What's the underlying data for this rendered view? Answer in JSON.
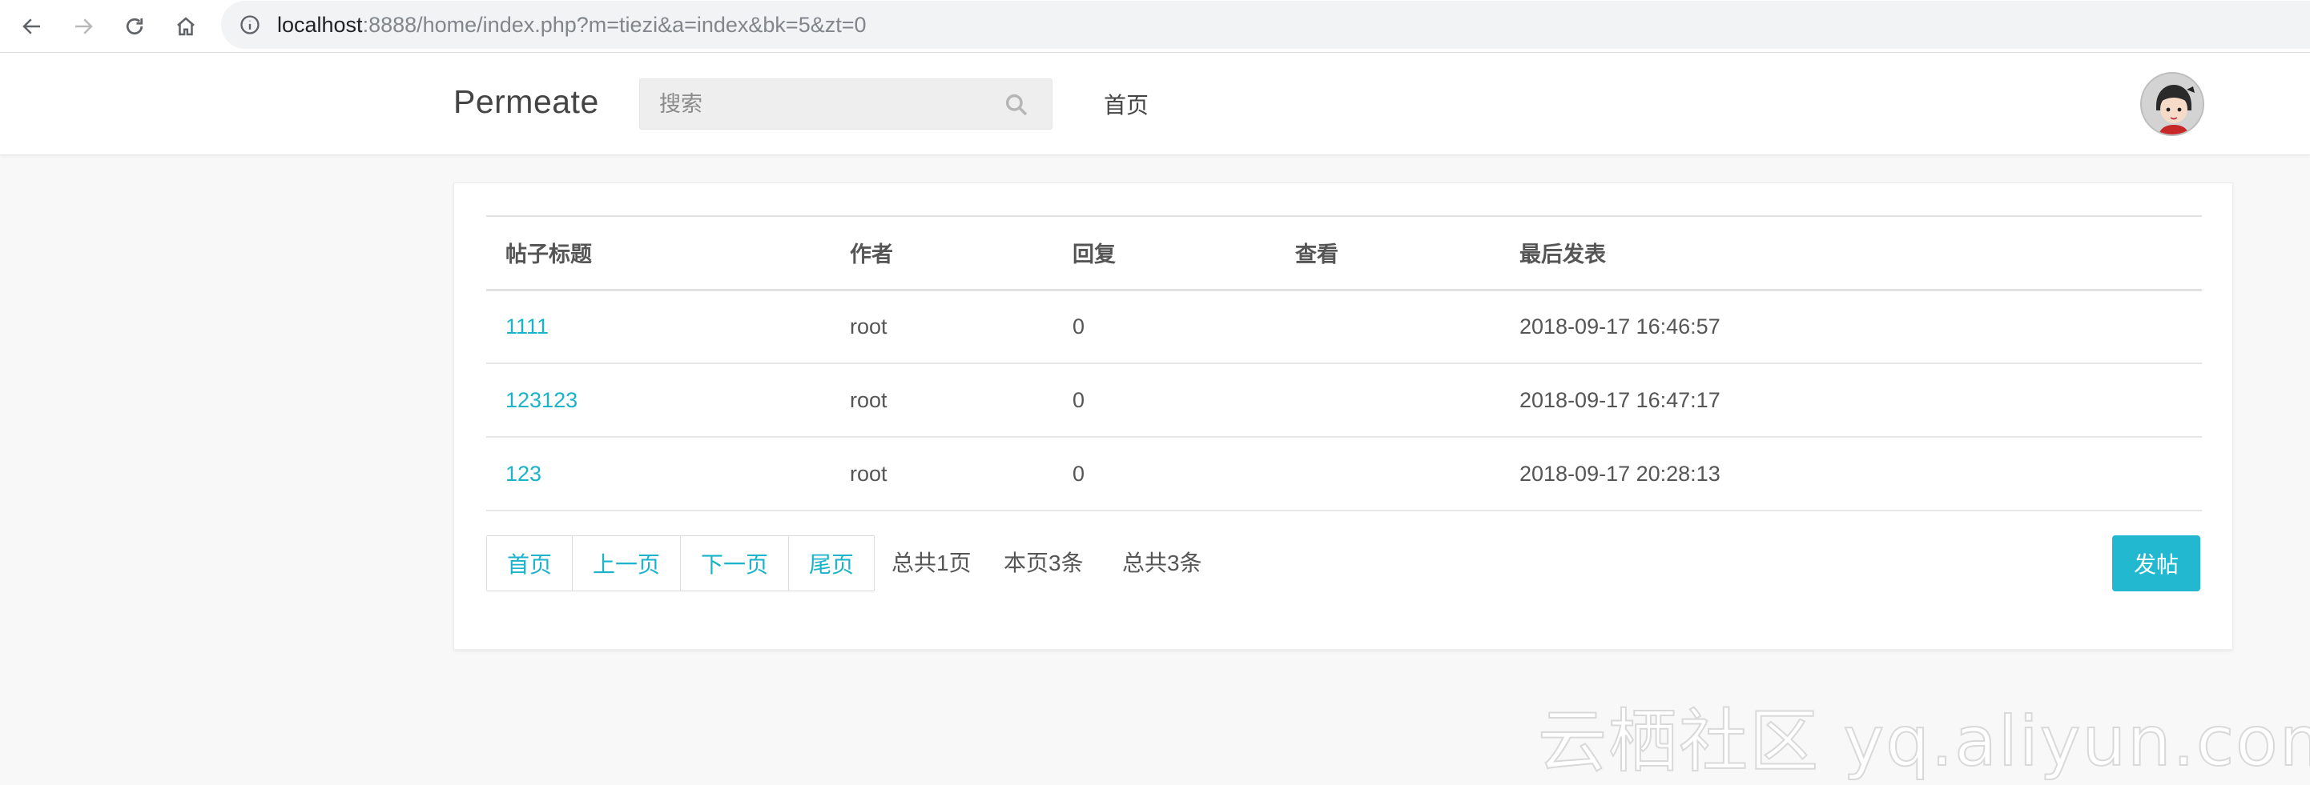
{
  "browser": {
    "url_host": "localhost",
    "url_rest": ":8888/home/index.php?m=tiezi&a=index&bk=5&zt=0"
  },
  "header": {
    "brand": "Permeate",
    "search_placeholder": "搜索",
    "nav_home": "首页"
  },
  "table": {
    "columns": [
      "帖子标题",
      "作者",
      "回复",
      "查看",
      "最后发表"
    ],
    "rows": [
      {
        "title": "1111",
        "author": "root",
        "replies": "0",
        "views": "",
        "last_post": "2018-09-17 16:46:57"
      },
      {
        "title": "123123",
        "author": "root",
        "replies": "0",
        "views": "",
        "last_post": "2018-09-17 16:47:17"
      },
      {
        "title": "123",
        "author": "root",
        "replies": "0",
        "views": "",
        "last_post": "2018-09-17 20:28:13"
      }
    ]
  },
  "pager": {
    "first": "首页",
    "prev": "上一页",
    "next": "下一页",
    "last": "尾页",
    "total_pages": "总共1页",
    "this_page_count": "本页3条",
    "total_count": "总共3条"
  },
  "post_button": "发帖",
  "watermark": "云栖社区 yq.aliyun.com",
  "colors": {
    "accent": "#1ab3c9",
    "button": "#22b8cf"
  }
}
